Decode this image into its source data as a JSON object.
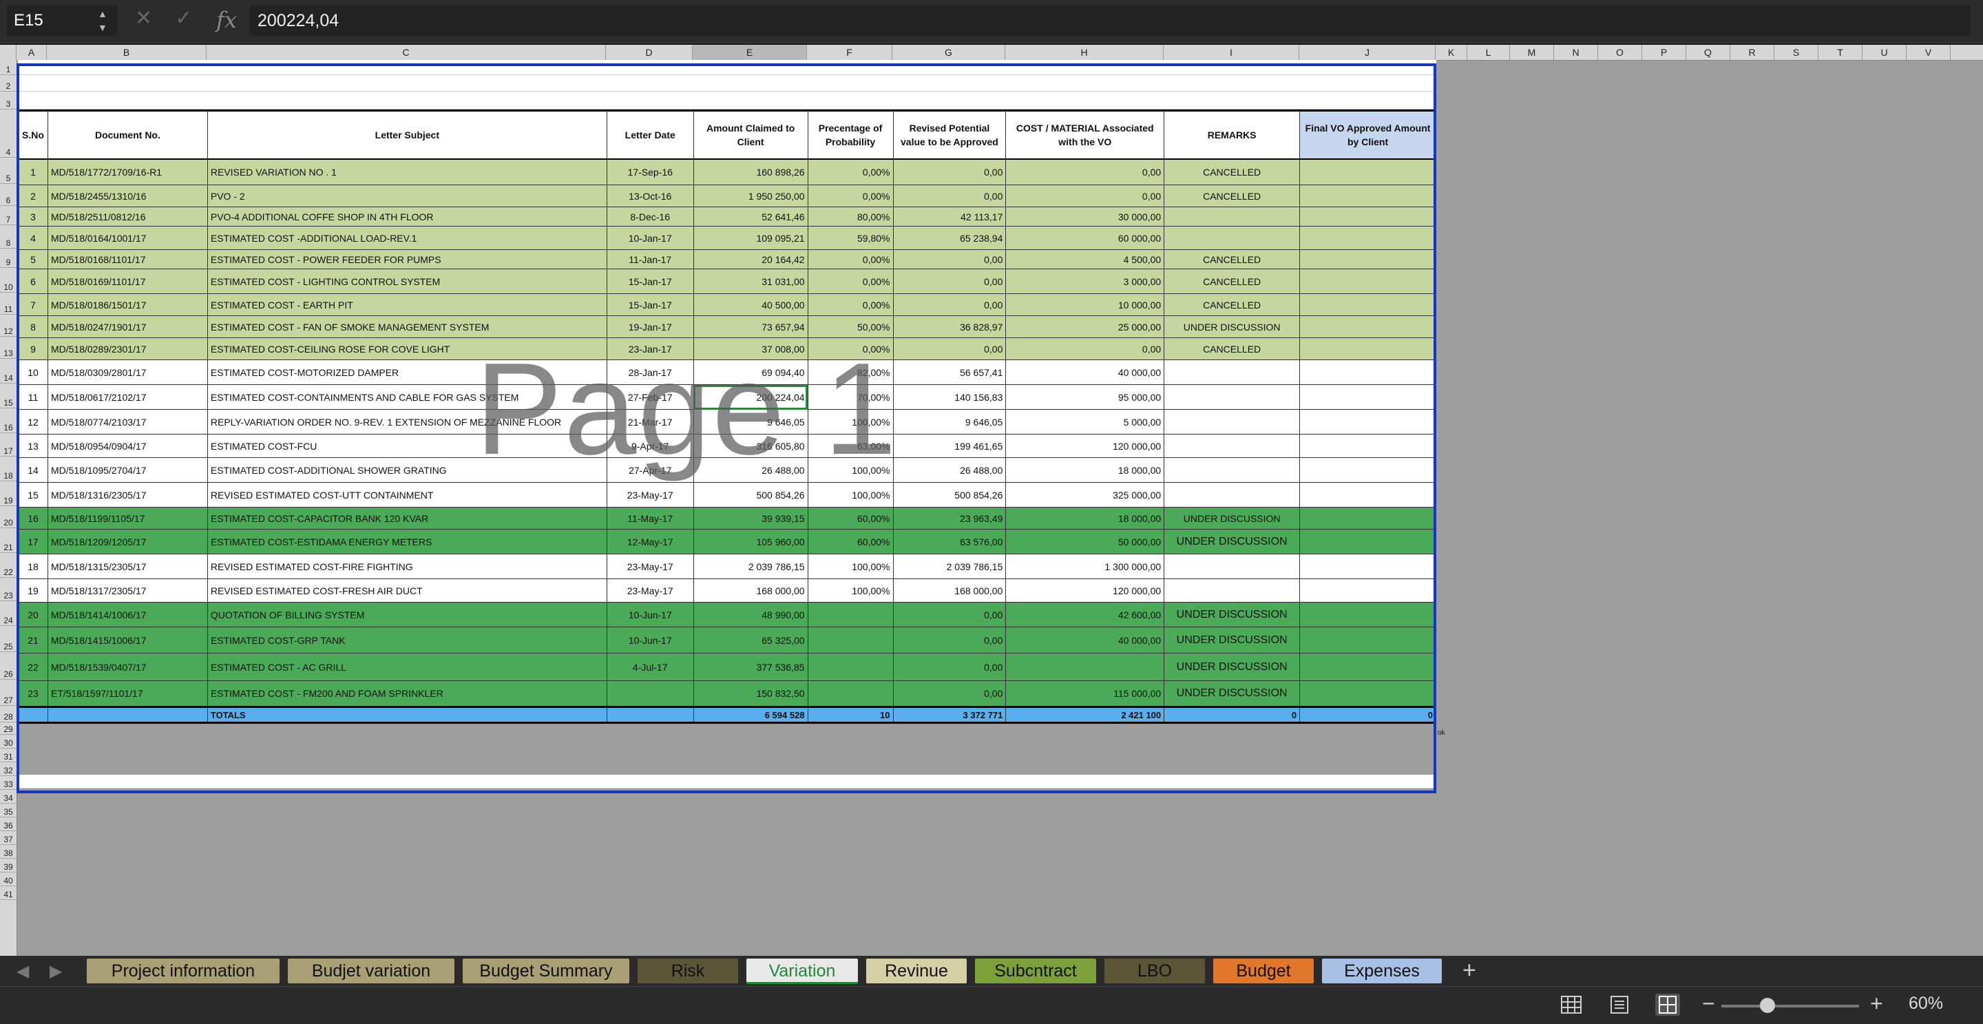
{
  "formula_bar": {
    "cell_ref": "E15",
    "formula": "200224,04"
  },
  "columns": [
    "A",
    "B",
    "C",
    "D",
    "E",
    "F",
    "G",
    "H",
    "I",
    "J",
    "K",
    "L",
    "M",
    "N",
    "O",
    "P",
    "Q",
    "R",
    "S",
    "T",
    "U",
    "V"
  ],
  "selected_column": "E",
  "row_numbers": [
    "1",
    "2",
    "3",
    "4",
    "5",
    "6",
    "7",
    "8",
    "9",
    "10",
    "11",
    "12",
    "13",
    "14",
    "15",
    "16",
    "17",
    "18",
    "19",
    "20",
    "21",
    "22",
    "23",
    "24",
    "25",
    "26",
    "27",
    "28",
    "29",
    "30",
    "31",
    "32",
    "33",
    "34",
    "35",
    "36",
    "37",
    "38",
    "39",
    "40",
    "41"
  ],
  "headers": {
    "sno": "S.No",
    "doc": "Document No.",
    "subject": "Letter Subject",
    "date": "Letter Date",
    "amount": "Amount Claimed to Client",
    "pct": "Precentage of Probability",
    "revised": "Revised Potential value to be Approved",
    "cost": "COST / MATERIAL Associated with the VO",
    "remarks": "REMARKS",
    "final": "Final VO Approved Amount by Client"
  },
  "rows": [
    {
      "sno": "1",
      "doc": "MD/518/1772/1709/16-R1",
      "subject": "REVISED VARIATION NO . 1",
      "date": "17-Sep-16",
      "amount": "160 898,26",
      "pct": "0,00%",
      "revised": "0,00",
      "cost": "0,00",
      "remarks": "CANCELLED",
      "final": ""
    },
    {
      "sno": "2",
      "doc": "MD/518/2455/1310/16",
      "subject": "PVO - 2",
      "date": "13-Oct-16",
      "amount": "1 950 250,00",
      "pct": "0,00%",
      "revised": "0,00",
      "cost": "0,00",
      "remarks": "CANCELLED",
      "final": ""
    },
    {
      "sno": "3",
      "doc": "MD/518/2511/0812/16",
      "subject": "PVO-4 ADDITIONAL COFFE SHOP IN 4TH FLOOR",
      "date": "8-Dec-16",
      "amount": "52 641,46",
      "pct": "80,00%",
      "revised": "42 113,17",
      "cost": "30 000,00",
      "remarks": "",
      "final": ""
    },
    {
      "sno": "4",
      "doc": "MD/518/0164/1001/17",
      "subject": "ESTIMATED COST -ADDITIONAL LOAD-REV.1",
      "date": "10-Jan-17",
      "amount": "109 095,21",
      "pct": "59,80%",
      "revised": "65 238,94",
      "cost": "60 000,00",
      "remarks": "",
      "final": ""
    },
    {
      "sno": "5",
      "doc": "MD/518/0168/1101/17",
      "subject": "ESTIMATED COST - POWER FEEDER FOR PUMPS",
      "date": "11-Jan-17",
      "amount": "20 164,42",
      "pct": "0,00%",
      "revised": "0,00",
      "cost": "4 500,00",
      "remarks": "CANCELLED",
      "final": ""
    },
    {
      "sno": "6",
      "doc": "MD/518/0169/1101/17",
      "subject": "ESTIMATED COST - LIGHTING CONTROL SYSTEM",
      "date": "15-Jan-17",
      "amount": "31 031,00",
      "pct": "0,00%",
      "revised": "0,00",
      "cost": "3 000,00",
      "remarks": "CANCELLED",
      "final": ""
    },
    {
      "sno": "7",
      "doc": "MD/518/0186/1501/17",
      "subject": "ESTIMATED COST - EARTH PIT",
      "date": "15-Jan-17",
      "amount": "40 500,00",
      "pct": "0,00%",
      "revised": "0,00",
      "cost": "10 000,00",
      "remarks": "CANCELLED",
      "final": ""
    },
    {
      "sno": "8",
      "doc": "MD/518/0247/1901/17",
      "subject": "ESTIMATED COST - FAN OF SMOKE MANAGEMENT SYSTEM",
      "date": "19-Jan-17",
      "amount": "73 657,94",
      "pct": "50,00%",
      "revised": "36 828,97",
      "cost": "25 000,00",
      "remarks": "UNDER DISCUSSION",
      "final": ""
    },
    {
      "sno": "9",
      "doc": "MD/518/0289/2301/17",
      "subject": "ESTIMATED COST-CEILING ROSE FOR COVE LIGHT",
      "date": "23-Jan-17",
      "amount": "37 008,00",
      "pct": "0,00%",
      "revised": "0,00",
      "cost": "0,00",
      "remarks": "CANCELLED",
      "final": ""
    },
    {
      "sno": "10",
      "doc": "MD/518/0309/2801/17",
      "subject": "ESTIMATED COST-MOTORIZED DAMPER",
      "date": "28-Jan-17",
      "amount": "69 094,40",
      "pct": "82,00%",
      "revised": "56 657,41",
      "cost": "40 000,00",
      "remarks": "",
      "final": ""
    },
    {
      "sno": "11",
      "doc": "MD/518/0617/2102/17",
      "subject": "ESTIMATED COST-CONTAINMENTS AND CABLE FOR GAS SYSTEM",
      "date": "27-Feb-17",
      "amount": "200 224,04",
      "pct": "70,00%",
      "revised": "140 156,83",
      "cost": "95 000,00",
      "remarks": "",
      "final": ""
    },
    {
      "sno": "12",
      "doc": "MD/518/0774/2103/17",
      "subject": "REPLY-VARIATION ORDER NO. 9-REV. 1 EXTENSION OF MEZZANINE FLOOR",
      "date": "21-Mar-17",
      "amount": "9 646,05",
      "pct": "100,00%",
      "revised": "9 646,05",
      "cost": "5 000,00",
      "remarks": "",
      "final": ""
    },
    {
      "sno": "13",
      "doc": "MD/518/0954/0904/17",
      "subject": "ESTIMATED COST-FCU",
      "date": "9-Apr-17",
      "amount": "316 605,80",
      "pct": "63,00%",
      "revised": "199 461,65",
      "cost": "120 000,00",
      "remarks": "",
      "final": ""
    },
    {
      "sno": "14",
      "doc": "MD/518/1095/2704/17",
      "subject": "ESTIMATED COST-ADDITIONAL SHOWER GRATING",
      "date": "27-Apr-17",
      "amount": "26 488,00",
      "pct": "100,00%",
      "revised": "26 488,00",
      "cost": "18 000,00",
      "remarks": "",
      "final": ""
    },
    {
      "sno": "15",
      "doc": "MD/518/1316/2305/17",
      "subject": "REVISED ESTIMATED COST-UTT CONTAINMENT",
      "date": "23-May-17",
      "amount": "500 854,26",
      "pct": "100,00%",
      "revised": "500 854,26",
      "cost": "325 000,00",
      "remarks": "",
      "final": ""
    },
    {
      "sno": "16",
      "doc": "MD/518/1199/1105/17",
      "subject": "ESTIMATED COST-CAPACITOR BANK 120 KVAR",
      "date": "11-May-17",
      "amount": "39 939,15",
      "pct": "60,00%",
      "revised": "23 963,49",
      "cost": "18 000,00",
      "remarks": "UNDER DISCUSSION",
      "final": ""
    },
    {
      "sno": "17",
      "doc": "MD/518/1209/1205/17",
      "subject": "ESTIMATED COST-ESTIDAMA ENERGY METERS",
      "date": "12-May-17",
      "amount": "105 960,00",
      "pct": "60,00%",
      "revised": "63 576,00",
      "cost": "50 000,00",
      "remarks": "UNDER DISCUSSION",
      "final": ""
    },
    {
      "sno": "18",
      "doc": "MD/518/1315/2305/17",
      "subject": "REVISED ESTIMATED COST-FIRE FIGHTING",
      "date": "23-May-17",
      "amount": "2 039 786,15",
      "pct": "100,00%",
      "revised": "2 039 786,15",
      "cost": "1 300 000,00",
      "remarks": "",
      "final": ""
    },
    {
      "sno": "19",
      "doc": "MD/518/1317/2305/17",
      "subject": "REVISED ESTIMATED COST-FRESH AIR DUCT",
      "date": "23-May-17",
      "amount": "168 000,00",
      "pct": "100,00%",
      "revised": "168 000,00",
      "cost": "120 000,00",
      "remarks": "",
      "final": ""
    },
    {
      "sno": "20",
      "doc": "MD/518/1414/1006/17",
      "subject": "QUOTATION OF BILLING SYSTEM",
      "date": "10-Jun-17",
      "amount": "48 990,00",
      "pct": "",
      "revised": "0,00",
      "cost": "42 600,00",
      "remarks": "UNDER DISCUSSION",
      "final": ""
    },
    {
      "sno": "21",
      "doc": "MD/518/1415/1006/17",
      "subject": "ESTIMATED COST-GRP TANK",
      "date": "10-Jun-17",
      "amount": "65 325,00",
      "pct": "",
      "revised": "0,00",
      "cost": "40 000,00",
      "remarks": "UNDER DISCUSSION",
      "final": ""
    },
    {
      "sno": "22",
      "doc": "MD/518/1539/0407/17",
      "subject": "ESTIMATED COST - AC GRILL",
      "date": "4-Jul-17",
      "amount": "377 536,85",
      "pct": "",
      "revised": "0,00",
      "cost": "",
      "remarks": "UNDER DISCUSSION",
      "final": ""
    },
    {
      "sno": "23",
      "doc": "ET/518/1597/1101/17",
      "subject": "ESTIMATED COST - FM200 AND FOAM SPRINKLER",
      "date": "",
      "amount": "150 832,50",
      "pct": "",
      "revised": "0,00",
      "cost": "115 000,00",
      "remarks": "UNDER DISCUSSION",
      "final": ""
    }
  ],
  "totals": {
    "label": "TOTALS",
    "amount": "6 594 528",
    "pct": "10",
    "revised": "3 372 771",
    "cost": "2 421 100",
    "remarks": "0",
    "final": "0"
  },
  "watermark": "Page 1",
  "side_mark": "ok",
  "sheet_tabs": [
    {
      "label": "Project information",
      "color": "#a8a074"
    },
    {
      "label": "Budjet variation",
      "color": "#a8a074"
    },
    {
      "label": "Budget Summary",
      "color": "#a8a074"
    },
    {
      "label": "Risk",
      "color": "#5b5638"
    },
    {
      "label": "Variation",
      "color": "#e8e8e8"
    },
    {
      "label": "Revinue",
      "color": "#d5d0a8"
    },
    {
      "label": "Subcntract",
      "color": "#7da03a"
    },
    {
      "label": "LBO",
      "color": "#5b5638"
    },
    {
      "label": "Budget",
      "color": "#e0772a"
    },
    {
      "label": "Expenses",
      "color": "#a8c0e4"
    }
  ],
  "active_tab": "Variation",
  "zoom": "60%"
}
